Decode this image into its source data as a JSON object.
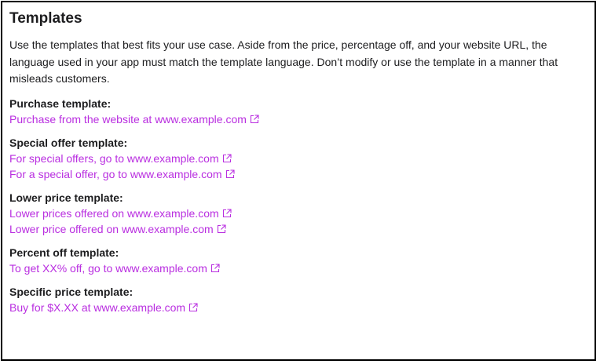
{
  "title": "Templates",
  "intro": "Use the templates that best fits your use case. Aside from the price, percentage off, and your website URL, the language used in your app must match the template language. Don’t modify or use the template in a manner that misleads customers.",
  "groups": [
    {
      "title": "Purchase template:",
      "links": [
        "Purchase from the website at www.example.com"
      ]
    },
    {
      "title": "Special offer template:",
      "links": [
        "For special offers, go to www.example.com",
        "For a special offer, go to www.example.com"
      ]
    },
    {
      "title": "Lower price template:",
      "links": [
        "Lower prices offered on www.example.com",
        "Lower price offered on www.example.com"
      ]
    },
    {
      "title": "Percent off template:",
      "links": [
        "To get XX% off, go to www.example.com"
      ]
    },
    {
      "title": "Specific price template:",
      "links": [
        "Buy for $X.XX at www.example.com"
      ]
    }
  ],
  "link_icon": "external-link-icon",
  "colors": {
    "link": "#b92ee0",
    "text": "#1d1d1f",
    "border": "#000000"
  }
}
